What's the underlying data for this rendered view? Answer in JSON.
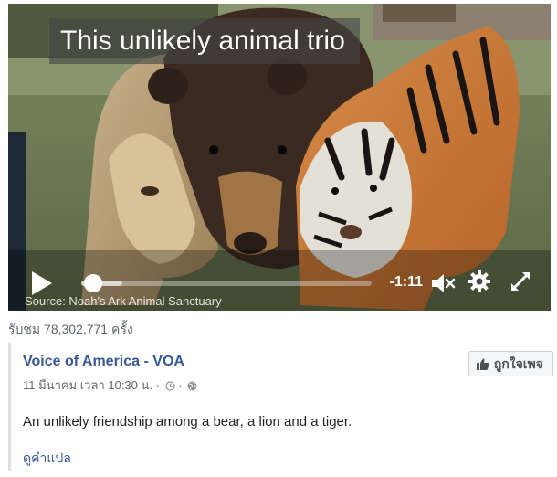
{
  "video": {
    "caption": "This unlikely animal trio",
    "time_remaining": "-1:11",
    "progress_fraction": 0.04,
    "buffered_fraction": 0.14,
    "source_credit": "Source: Noah's Ark Animal Sanctuary",
    "icons": {
      "play": "play-icon",
      "mute": "speaker-muted-icon",
      "settings": "gear-icon",
      "fullscreen": "expand-icon"
    }
  },
  "views": "รับชม 78,302,771 ครั้ง",
  "post": {
    "page_name": "Voice of America - VOA",
    "timestamp": "11 มีนาคม เวลา 10:30 น.",
    "separator": " · ",
    "like_button": "ถูกใจเพจ",
    "message": "An unlikely friendship among a bear, a lion and a tiger.",
    "translate_link": "ดูคำแปล"
  },
  "colors": {
    "link": "#365899",
    "secondary_text": "#606770",
    "border": "#dddfe2"
  }
}
